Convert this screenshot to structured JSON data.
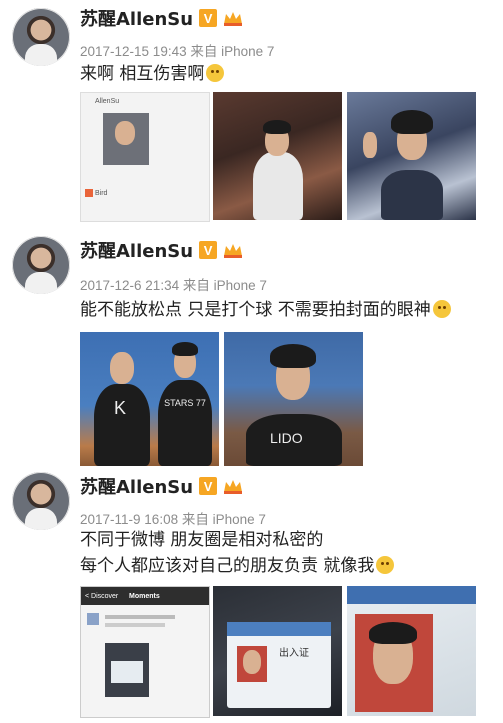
{
  "posts": [
    {
      "author": "苏醒AllenSu",
      "verified_badge": "V",
      "timestamp": "2017-12-15 19:43",
      "source": "来自 iPhone 7",
      "text": "来啊 相互伤害啊"
    },
    {
      "author": "苏醒AllenSu",
      "verified_badge": "V",
      "timestamp": "2017-12-6 21:34",
      "source": "来自 iPhone 7",
      "text": "能不能放松点 只是打个球 不需要拍封面的眼神"
    },
    {
      "author": "苏醒AllenSu",
      "verified_badge": "V",
      "timestamp": "2017-11-9 16:08",
      "source": "来自 iPhone 7",
      "text_line1": "不同于微博 朋友圈是相对私密的",
      "text_line2": "每个人都应该对自己的朋友负责 就像我"
    }
  ],
  "images": {
    "post1_chat_name1": "AllenSu",
    "post1_chat_name2": "Bird",
    "post2_jersey_left": "K",
    "post2_jersey_mid": "STARS 77",
    "post2_jersey_right": "LIDO",
    "post3_phone_header": "Moments",
    "post3_phone_back": "< Discover",
    "post3_card_title": "出入证"
  },
  "colors": {
    "badge_orange": "#f6a623",
    "meta_gray": "#8c8c8c",
    "text_dark": "#222222"
  }
}
